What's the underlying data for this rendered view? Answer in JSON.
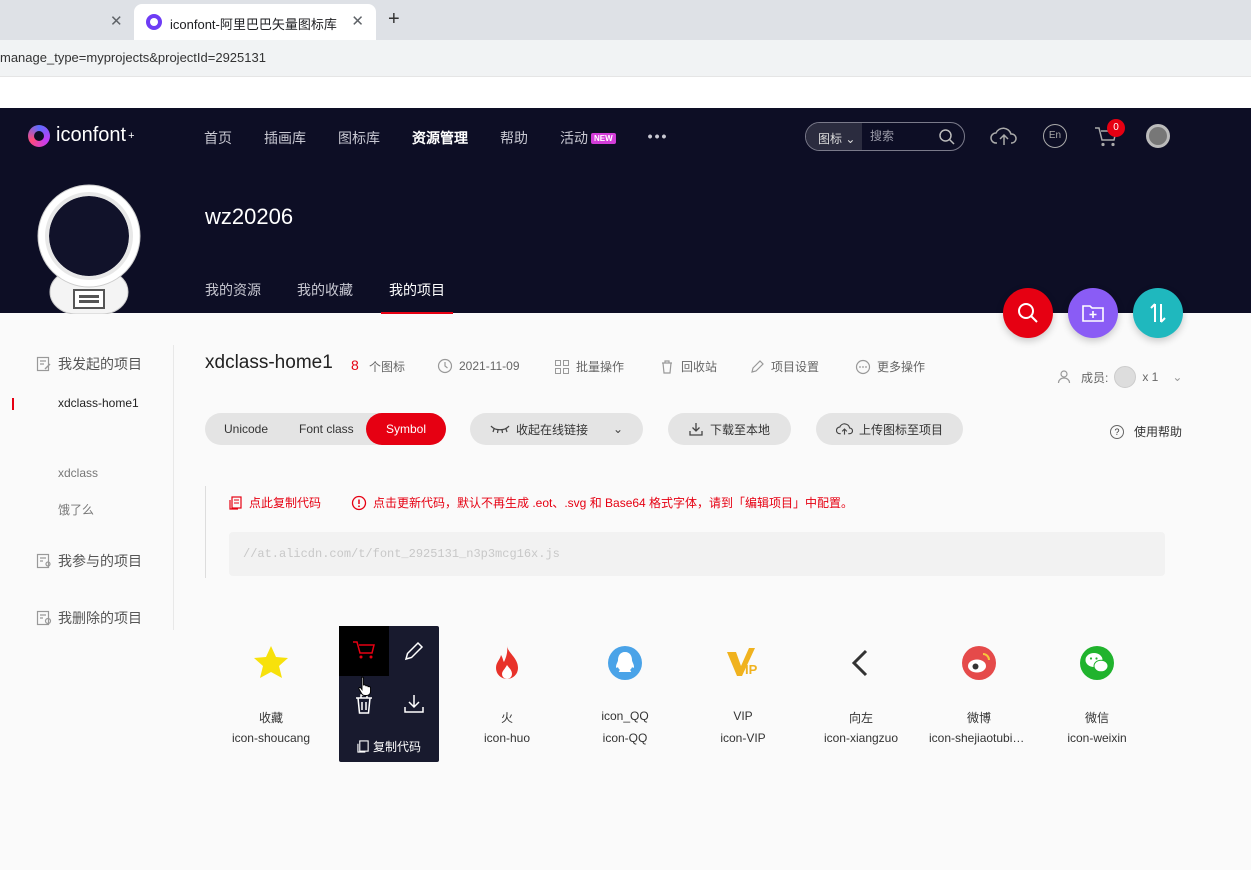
{
  "browser": {
    "tab_title": "iconfont-阿里巴巴矢量图标库",
    "url": "manage_type=myprojects&projectId=2925131"
  },
  "header": {
    "logo_text": "iconfont",
    "nav": [
      "首页",
      "插画库",
      "图标库",
      "资源管理",
      "帮助",
      "活动"
    ],
    "new_badge": "NEW",
    "search_type": "图标",
    "search_placeholder": "搜索",
    "lang": "En",
    "cart_count": "0"
  },
  "profile": {
    "username": "wz20206",
    "tabs": [
      "我的资源",
      "我的收藏",
      "我的项目"
    ]
  },
  "sidebar": {
    "initiated": {
      "title": "我发起的项目",
      "items": [
        "xdclass-home1",
        "",
        "xdclass",
        "饿了么"
      ]
    },
    "joined_title": "我参与的项目",
    "deleted_title": "我删除的项目"
  },
  "project": {
    "name": "xdclass-home1",
    "icon_count": "8",
    "icon_count_label": "个图标",
    "date": "2021-11-09",
    "batch": "批量操作",
    "recycle": "回收站",
    "settings": "项目设置",
    "more": "更多操作",
    "members_label": "成员:",
    "members_count": "x 1"
  },
  "toolbar": {
    "unicode": "Unicode",
    "font_class": "Font class",
    "symbol": "Symbol",
    "collapse_link": "收起在线链接",
    "download": "下载至本地",
    "upload": "上传图标至项目",
    "help": "使用帮助",
    "help_mark": "?"
  },
  "code": {
    "copy_label": "点此复制代码",
    "warning": "点击更新代码，默认不再生成 .eot、.svg 和 Base64 格式字体，请到「编辑项目」中配置。",
    "url": "//at.alicdn.com/t/font_2925131_n3p3mcg16x.js"
  },
  "hover_copy": "复制代码",
  "icons": [
    {
      "name": "收藏",
      "class": "icon-shoucang",
      "color": "#f7e10b"
    },
    {
      "name": "",
      "class": "",
      "color": "#e60012"
    },
    {
      "name": "火",
      "class": "icon-huo",
      "color": "#e8322a"
    },
    {
      "name": "icon_QQ",
      "class": "icon-QQ",
      "color": "#4aa3e8"
    },
    {
      "name": "VIP",
      "class": "icon-VIP",
      "color": "#f0b21e"
    },
    {
      "name": "向左",
      "class": "icon-xiangzuo",
      "color": "#333333"
    },
    {
      "name": "微博",
      "class": "icon-shejiaotubiao-weibo",
      "color": "#e54a4a"
    },
    {
      "name": "微信",
      "class": "icon-weixin",
      "color": "#20b32d"
    }
  ],
  "colors": {
    "brand_red": "#e60012",
    "header_bg": "#0d0e25",
    "fab_search": "#e60012",
    "fab_folder": "#8a5cf5",
    "fab_sort": "#1fb8be"
  }
}
